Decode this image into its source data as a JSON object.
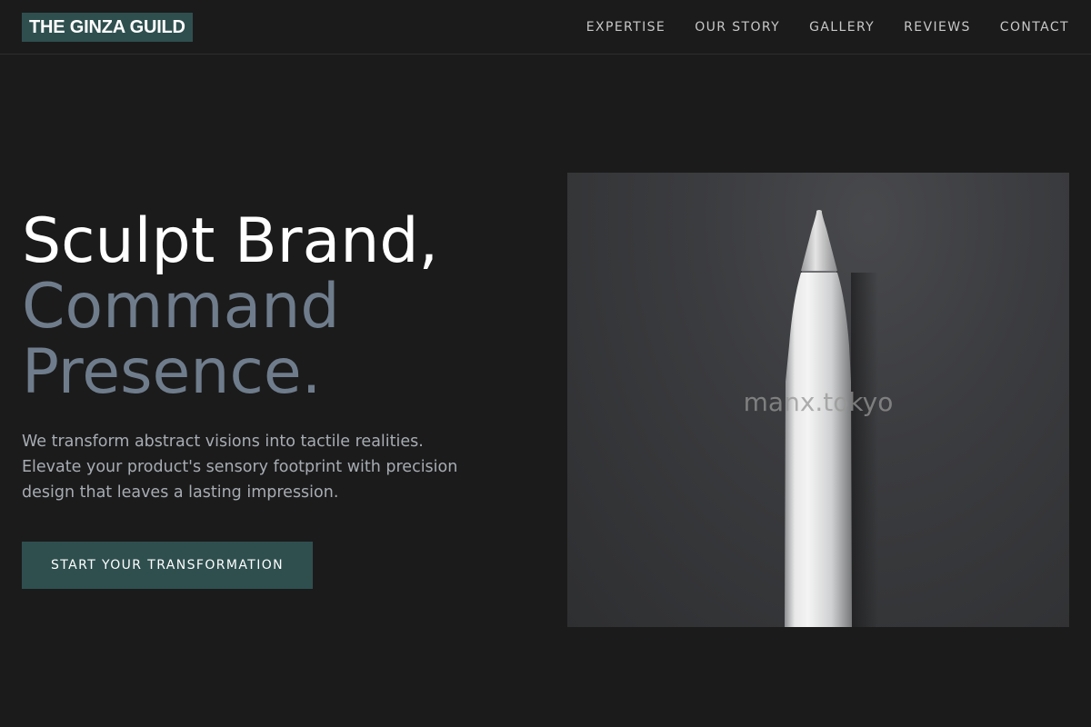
{
  "brand": {
    "name": "THE GINZA GUILD",
    "accent_color": "#2f4f4f"
  },
  "nav": {
    "items": [
      {
        "label": "EXPERTISE"
      },
      {
        "label": "OUR STORY"
      },
      {
        "label": "GALLERY"
      },
      {
        "label": "REVIEWS"
      },
      {
        "label": "CONTACT"
      }
    ]
  },
  "hero": {
    "title_line1": "Sculpt Brand,",
    "title_line2": "Command",
    "title_line3": "Presence.",
    "description": "We transform abstract visions into tactile realities. Elevate your product's sensory footprint with precision design that leaves a lasting impression.",
    "cta_label": "START YOUR TRANSFORMATION",
    "image": {
      "subject": "white-stylus-pen",
      "watermark": "manx.tokyo"
    }
  }
}
